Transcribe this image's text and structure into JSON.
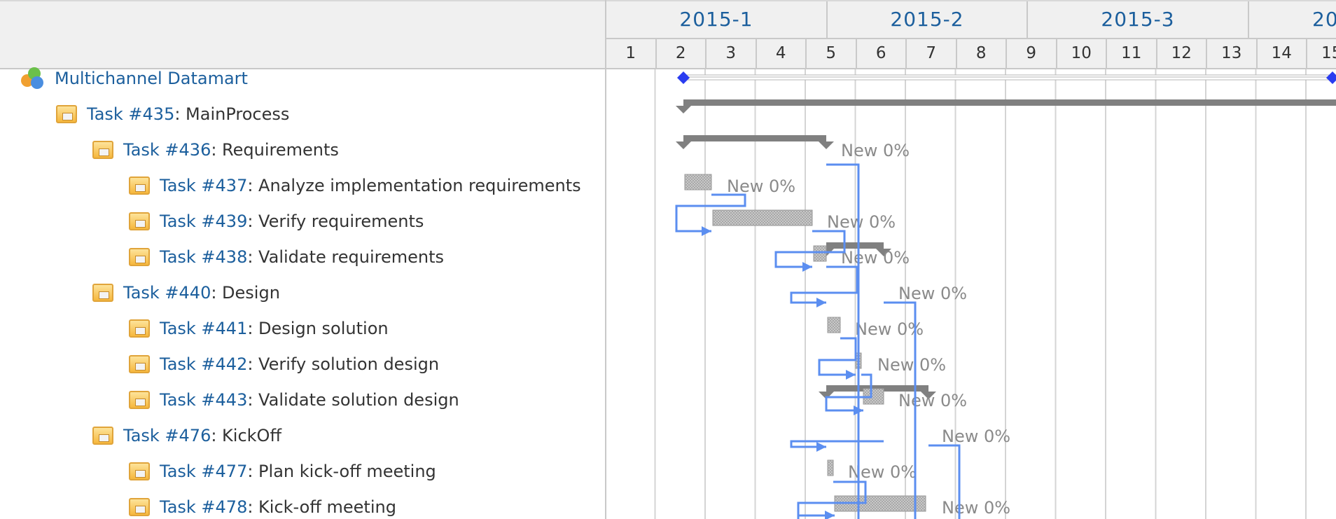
{
  "timeline": {
    "months": [
      "2015-1",
      "2015-2",
      "2015-3",
      "20"
    ],
    "days": [
      "1",
      "2",
      "3",
      "4",
      "5",
      "6",
      "7",
      "8",
      "9",
      "10",
      "11",
      "12",
      "13",
      "14",
      "15"
    ]
  },
  "tree": {
    "project": {
      "name": "Multichannel Datamart",
      "icon": "project-icon"
    },
    "tasks": [
      {
        "id": "Task #435",
        "name": ": MainProcess",
        "level": 1
      },
      {
        "id": "Task #436",
        "name": ": Requirements",
        "level": 2
      },
      {
        "id": "Task #437",
        "name": ": Analyze implementation requirements",
        "level": 3
      },
      {
        "id": "Task #439",
        "name": ": Verify requirements",
        "level": 3
      },
      {
        "id": "Task #438",
        "name": ": Validate requirements",
        "level": 3
      },
      {
        "id": "Task #440",
        "name": ": Design",
        "level": 2
      },
      {
        "id": "Task #441",
        "name": ": Design solution",
        "level": 3
      },
      {
        "id": "Task #442",
        "name": ": Verify solution design",
        "level": 3
      },
      {
        "id": "Task #443",
        "name": ": Validate solution design",
        "level": 3
      },
      {
        "id": "Task #476",
        "name": ": KickOff",
        "level": 2
      },
      {
        "id": "Task #477",
        "name": ": Plan kick-off meeting",
        "level": 3
      },
      {
        "id": "Task #478",
        "name": ": Kick-off meeting",
        "level": 3
      }
    ]
  },
  "bar_labels": [
    "New 0%",
    "New 0%",
    "New 0%",
    "New 0%",
    "New 0%",
    "New 0%",
    "New 0%",
    "New 0%",
    "New 0%",
    "New 0%",
    "New 0%"
  ],
  "colors": {
    "link": "#1c5f9d",
    "dependency": "#5b8ef0",
    "summary_bar": "#808080",
    "milestone": "#2a3cf0",
    "task_bar": "#c4c4c4"
  }
}
